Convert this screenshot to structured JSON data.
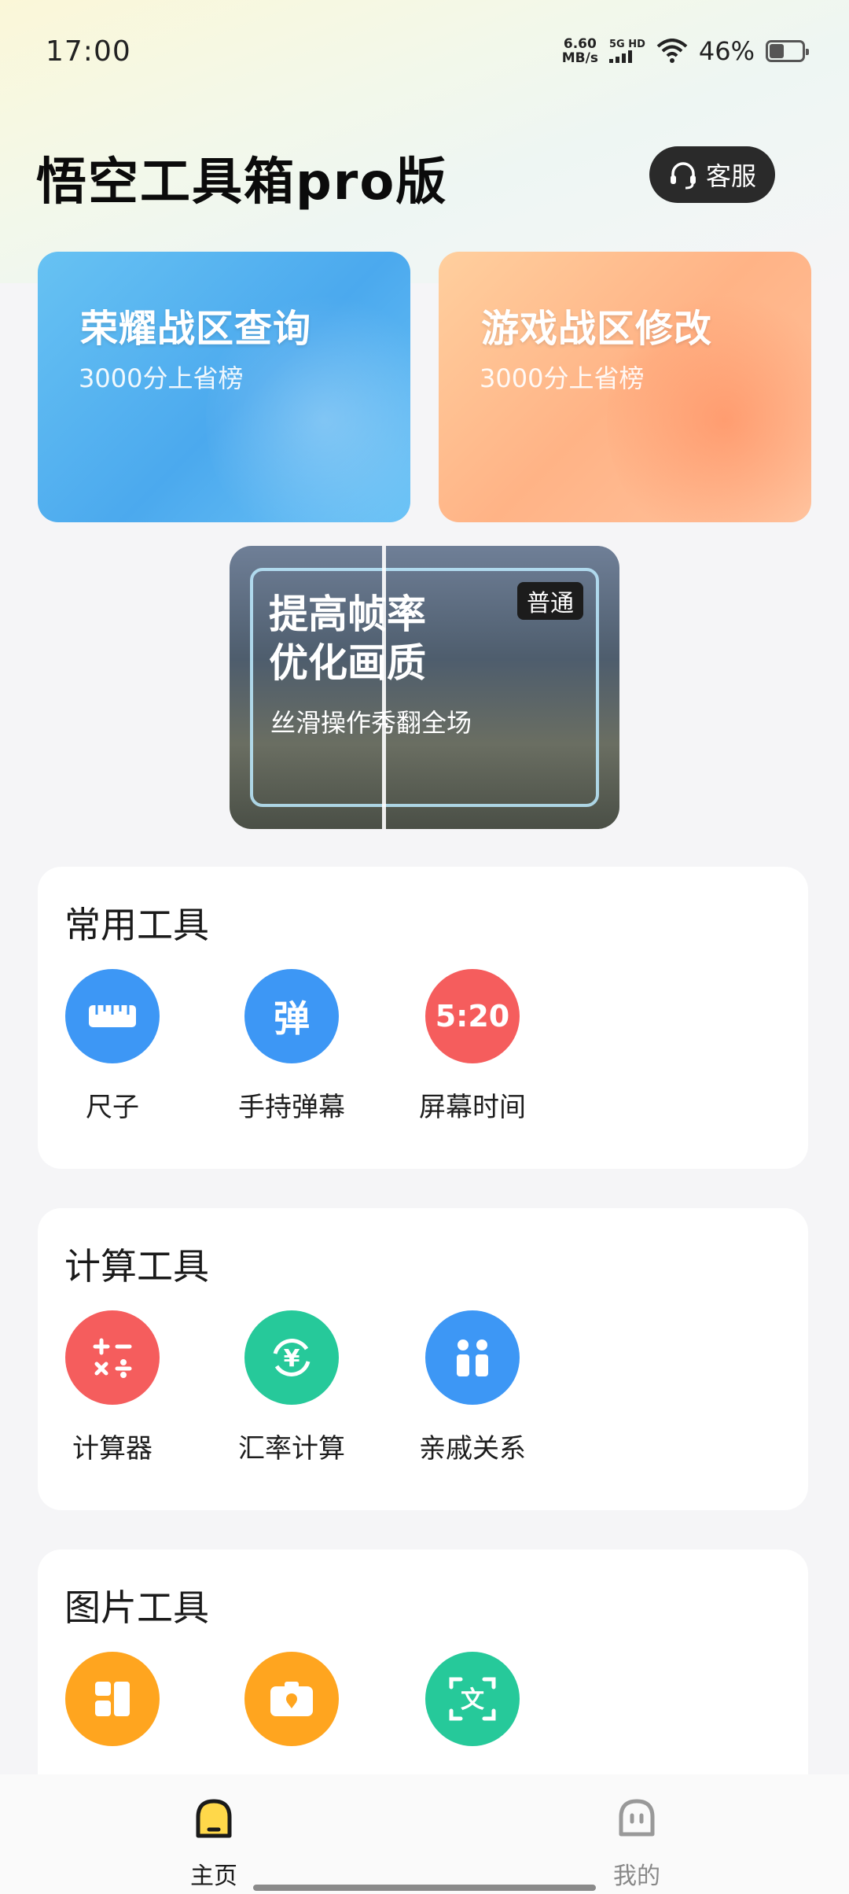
{
  "status_bar": {
    "time": "17:00",
    "net_speed_value": "6.60",
    "net_speed_unit": "MB/s",
    "network_label": "5G HD",
    "battery_text": "46%",
    "battery_level": 0.46
  },
  "header": {
    "title": "悟空工具箱pro版",
    "service_label": "客服"
  },
  "banners": [
    {
      "title": "荣耀战区查询",
      "subtitle": "3000分上省榜"
    },
    {
      "title": "游戏战区修改",
      "subtitle": "3000分上省榜"
    }
  ],
  "promo": {
    "title_line1": "提高帧率",
    "title_line2": "优化画质",
    "subtitle": "丝滑操作秀翻全场",
    "tag": "普通"
  },
  "sections": [
    {
      "title": "常用工具",
      "tools": [
        {
          "label": "尺子",
          "icon": "ruler-icon",
          "color": "#3d97f5",
          "glyph": "▭"
        },
        {
          "label": "手持弹幕",
          "icon": "barrage-icon",
          "color": "#3d97f5",
          "glyph": "弹"
        },
        {
          "label": "屏幕时间",
          "icon": "screen-time-icon",
          "color": "#f55d5d",
          "glyph": "5:20"
        }
      ]
    },
    {
      "title": "计算工具",
      "tools": [
        {
          "label": "计算器",
          "icon": "calculator-icon",
          "color": "#f55d5d",
          "glyph": "±"
        },
        {
          "label": "汇率计算",
          "icon": "exchange-rate-icon",
          "color": "#26c99a",
          "glyph": "¥"
        },
        {
          "label": "亲戚关系",
          "icon": "relatives-icon",
          "color": "#3d97f5",
          "glyph": "▮▮"
        }
      ]
    },
    {
      "title": "图片工具",
      "tools": [
        {
          "label": "",
          "icon": "image-layout-icon",
          "color": "#ffa51f",
          "glyph": "▣"
        },
        {
          "label": "",
          "icon": "id-photo-icon",
          "color": "#ffa51f",
          "glyph": "◉"
        },
        {
          "label": "",
          "icon": "ocr-text-icon",
          "color": "#26c99a",
          "glyph": "文"
        }
      ]
    }
  ],
  "bottom_nav": {
    "items": [
      {
        "label": "主页",
        "active": true
      },
      {
        "label": "我的",
        "active": false
      }
    ]
  },
  "colors": {
    "accent_blue": "#3d97f5",
    "accent_red": "#f55d5d",
    "accent_green": "#26c99a",
    "accent_orange": "#ffa51f",
    "home_icon_yellow": "#ffd84a"
  }
}
